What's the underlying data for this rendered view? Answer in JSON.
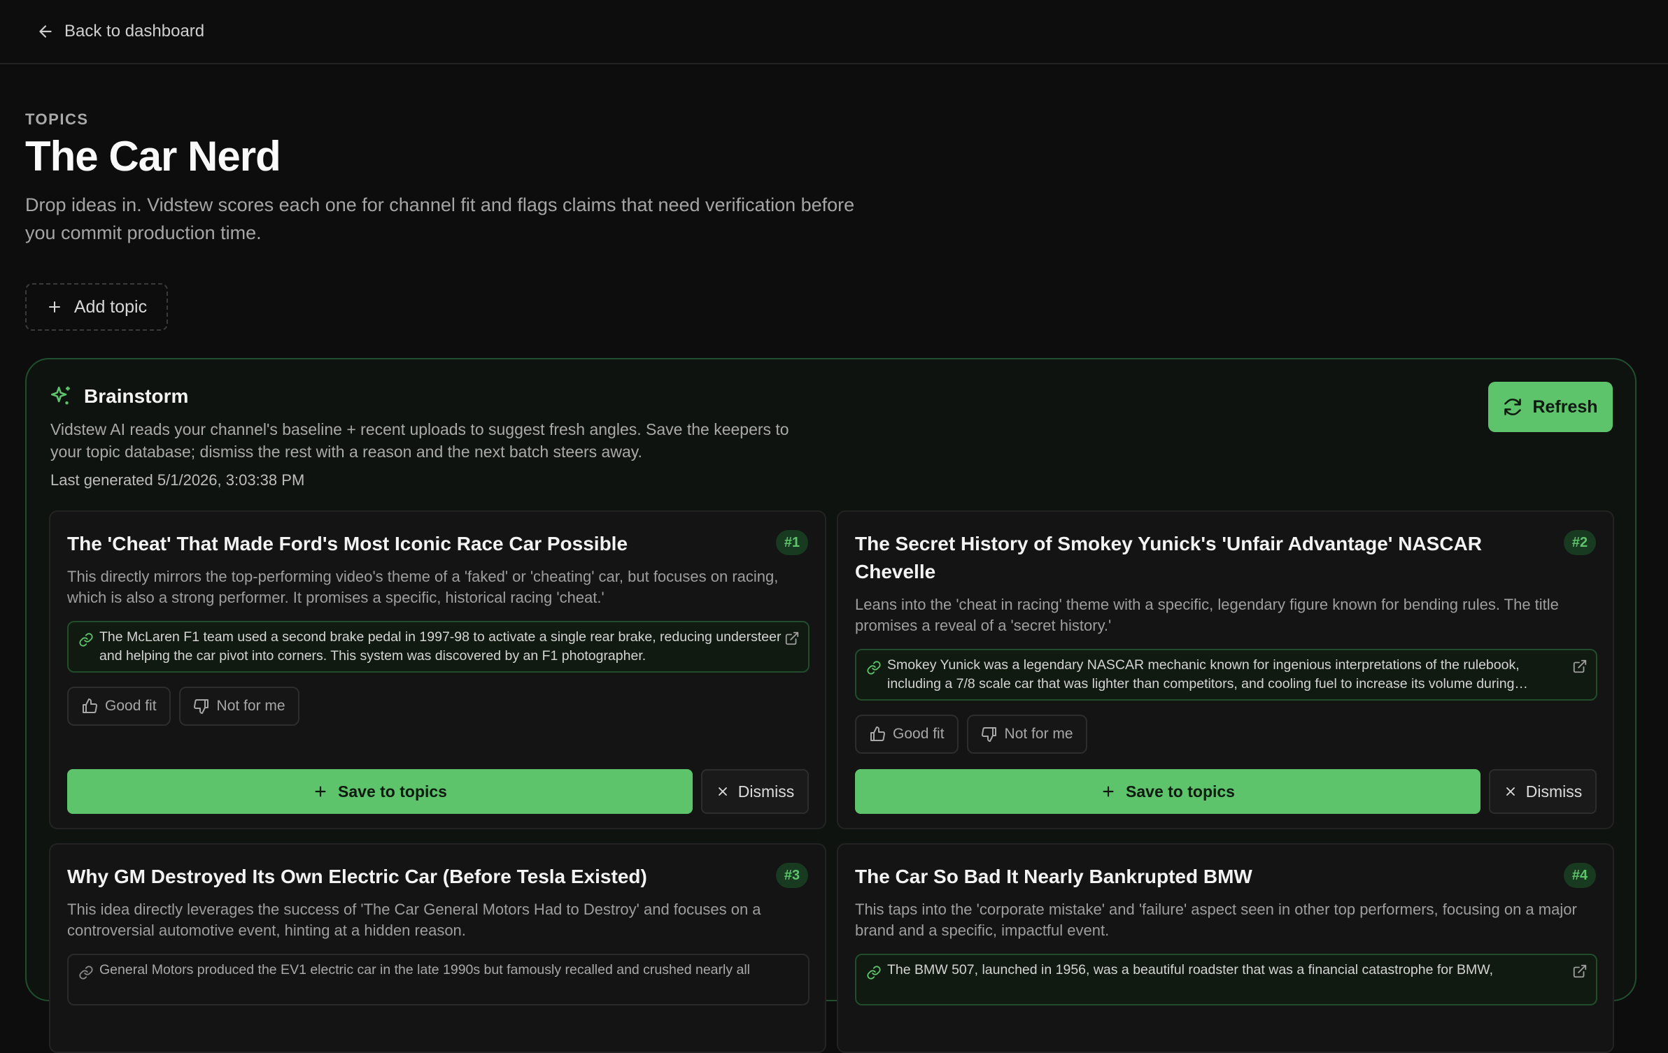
{
  "nav": {
    "back_label": "Back to dashboard"
  },
  "header": {
    "eyebrow": "TOPICS",
    "title": "The Car Nerd",
    "description": "Drop ideas in. Vidstew scores each one for channel fit and flags claims that need verification before you commit production time."
  },
  "add_topic_label": "Add topic",
  "brainstorm": {
    "title": "Brainstorm",
    "description": "Vidstew AI reads your channel's baseline + recent uploads to suggest fresh angles. Save the keepers to your topic database; dismiss the rest with a reason and the next batch steers away.",
    "last_generated": "Last generated 5/1/2026, 3:03:38 PM",
    "refresh_label": "Refresh",
    "ideas": [
      {
        "rank": "#1",
        "title": "The 'Cheat' That Made Ford's Most Iconic Race Car Possible",
        "reason": "This directly mirrors the top-performing video's theme of a 'faked' or 'cheating' car, but focuses on racing, which is also a strong performer. It promises a specific, historical racing 'cheat.'",
        "claim": "The McLaren F1 team used a second brake pedal in 1997-98 to activate a single rear brake, reducing understeer and helping the car pivot into corners. This system was discovered by an F1 photographer.",
        "good_fit": "Good fit",
        "not_for_me": "Not for me",
        "save": "Save to topics",
        "dismiss": "Dismiss"
      },
      {
        "rank": "#2",
        "title": "The Secret History of Smokey Yunick's 'Unfair Advantage' NASCAR Chevelle",
        "reason": "Leans into the 'cheat in racing' theme with a specific, legendary figure known for bending rules. The title promises a reveal of a 'secret history.'",
        "claim": "Smokey Yunick was a legendary NASCAR mechanic known for ingenious interpretations of the rulebook, including a 7/8 scale car that was lighter than competitors, and cooling fuel to increase its volume during refueling.",
        "good_fit": "Good fit",
        "not_for_me": "Not for me",
        "save": "Save to topics",
        "dismiss": "Dismiss"
      },
      {
        "rank": "#3",
        "title": "Why GM Destroyed Its Own Electric Car (Before Tesla Existed)",
        "reason": "This idea directly leverages the success of 'The Car General Motors Had to Destroy' and focuses on a controversial automotive event, hinting at a hidden reason.",
        "claim": "General Motors produced the EV1 electric car in the late 1990s but famously recalled and crushed nearly all"
      },
      {
        "rank": "#4",
        "title": "The Car So Bad It Nearly Bankrupted BMW",
        "reason": "This taps into the 'corporate mistake' and 'failure' aspect seen in other top performers, focusing on a major brand and a specific, impactful event.",
        "claim": "The BMW 507, launched in 1956, was a beautiful roadster that was a financial catastrophe for BMW,"
      }
    ]
  }
}
